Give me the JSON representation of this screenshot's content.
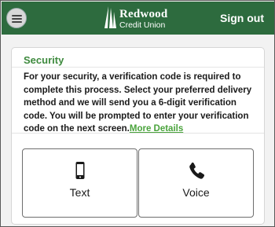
{
  "header": {
    "menu_icon": "hamburger-menu-icon",
    "logo_line1": "Redwood",
    "logo_line2": "Credit Union",
    "logo_icon": "redwood-tree-logo",
    "signout_label": "Sign out",
    "background_color": "#2d6b3e"
  },
  "security": {
    "title": "Security",
    "message": "For your security, a verification code is required to complete this process. Select your preferred delivery method and we will send you a 6-digit verification code. You will be prompted to enter your verification code on the next screen.",
    "more_link": "More Details",
    "accent_color": "#3e8a3e",
    "link_color": "#4aa33c"
  },
  "options": [
    {
      "label": "Text",
      "icon": "mobile-phone-icon"
    },
    {
      "label": "Voice",
      "icon": "phone-handset-icon"
    }
  ]
}
